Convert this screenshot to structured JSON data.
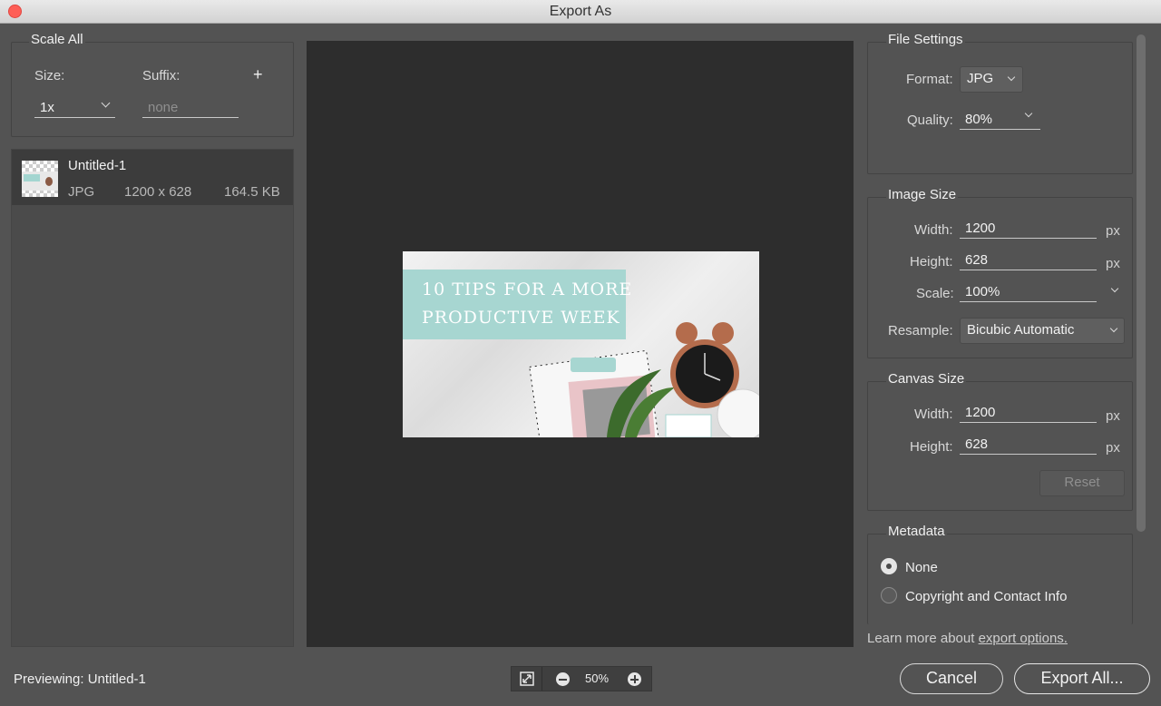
{
  "window": {
    "title": "Export As"
  },
  "scale_all": {
    "title": "Scale All",
    "size_label": "Size:",
    "suffix_label": "Suffix:",
    "add_symbol": "+",
    "size_value": "1x",
    "suffix_placeholder": "none"
  },
  "asset": {
    "name": "Untitled-1",
    "format": "JPG",
    "dimensions": "1200 x 628",
    "file_size": "164.5 KB"
  },
  "preview_image": {
    "line1": "10 TIPS FOR A MORE",
    "line2": "PRODUCTIVE WEEK"
  },
  "file_settings": {
    "title": "File Settings",
    "format_label": "Format:",
    "format_value": "JPG",
    "quality_label": "Quality:",
    "quality_value": "80%"
  },
  "image_size": {
    "title": "Image Size",
    "width_label": "Width:",
    "width_value": "1200",
    "height_label": "Height:",
    "height_value": "628",
    "scale_label": "Scale:",
    "scale_value": "100%",
    "resample_label": "Resample:",
    "resample_value": "Bicubic Automatic",
    "unit": "px"
  },
  "canvas_size": {
    "title": "Canvas Size",
    "width_label": "Width:",
    "width_value": "1200",
    "height_label": "Height:",
    "height_value": "628",
    "unit": "px",
    "reset_label": "Reset"
  },
  "metadata": {
    "title": "Metadata",
    "option_none": "None",
    "option_copyright": "Copyright and Contact Info",
    "selected": "None"
  },
  "learn_more": {
    "prefix": "Learn more about ",
    "link": "export options."
  },
  "footer": {
    "previewing": "Previewing: Untitled-1",
    "zoom": "50%",
    "cancel_label": "Cancel",
    "export_label": "Export All..."
  },
  "colors": {
    "background": "#535353",
    "preview_bg": "#2d2d2d",
    "banner": "#a7d6d1",
    "close": "#fe5f57"
  }
}
